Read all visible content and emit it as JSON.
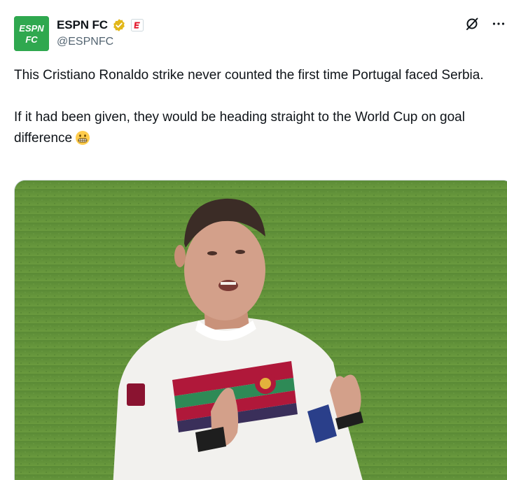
{
  "account": {
    "display_name": "ESPN FC",
    "handle": "@ESPNFC",
    "avatar_text_top": "ESPN",
    "avatar_text_bottom": "FC",
    "avatar_color": "#2fa84f",
    "verified_badge": "gold-check",
    "affiliate_badge": "espn-e"
  },
  "actions": {
    "grok_icon": "grok-icon",
    "more_icon": "more-icon"
  },
  "tweet": {
    "line1": "This Cristiano Ronaldo strike never counted the first time Portugal faced Serbia.",
    "line2": "If it had been given, they would be heading straight to the World Cup on goal difference",
    "emoji": "grimacing-face"
  },
  "media": {
    "type": "image"
  },
  "colors": {
    "text": "#0f1419",
    "secondary": "#536471",
    "verified_gold": "#e2b719"
  }
}
